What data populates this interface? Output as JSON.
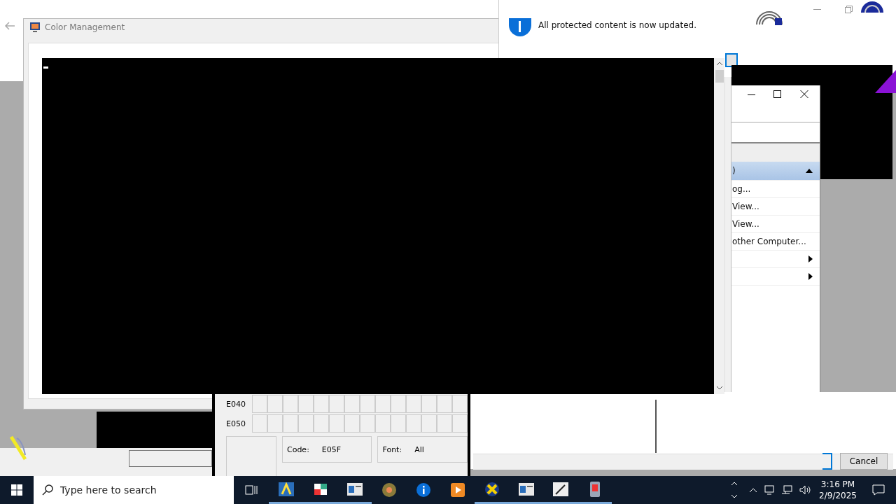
{
  "color_window": {
    "title": "Color Management"
  },
  "toast": {
    "message": "All protected content is now updated."
  },
  "menu": {
    "items": [
      {
        "label": ")",
        "selected": true,
        "kind": "header"
      },
      {
        "label": "og...",
        "selected": false,
        "kind": "item"
      },
      {
        "label": "View...",
        "selected": false,
        "kind": "item"
      },
      {
        "label": "View...",
        "selected": false,
        "kind": "item"
      },
      {
        "label": "other Computer...",
        "selected": false,
        "kind": "item"
      },
      {
        "selected": false,
        "kind": "submenu"
      },
      {
        "selected": false,
        "kind": "submenu"
      }
    ]
  },
  "char_map": {
    "rows": [
      "E040",
      "E050"
    ],
    "code_label": "Code:",
    "code": "E05F",
    "font_label": "Font:",
    "font": "All"
  },
  "dialog": {
    "cancel": "Cancel"
  },
  "taskbar": {
    "search_placeholder": "Type here to search",
    "apps": [
      {
        "kind": "font",
        "running": true
      },
      {
        "kind": "paint",
        "running": true
      },
      {
        "kind": "window",
        "running": true
      },
      {
        "kind": "disc",
        "running": false
      },
      {
        "kind": "info",
        "running": false
      },
      {
        "kind": "media",
        "running": false
      },
      {
        "kind": "tool",
        "running": true
      },
      {
        "kind": "window",
        "running": true
      },
      {
        "kind": "pen",
        "running": true
      },
      {
        "kind": "device",
        "running": true
      }
    ],
    "time": "3:16 PM",
    "date": "2/9/2025"
  }
}
